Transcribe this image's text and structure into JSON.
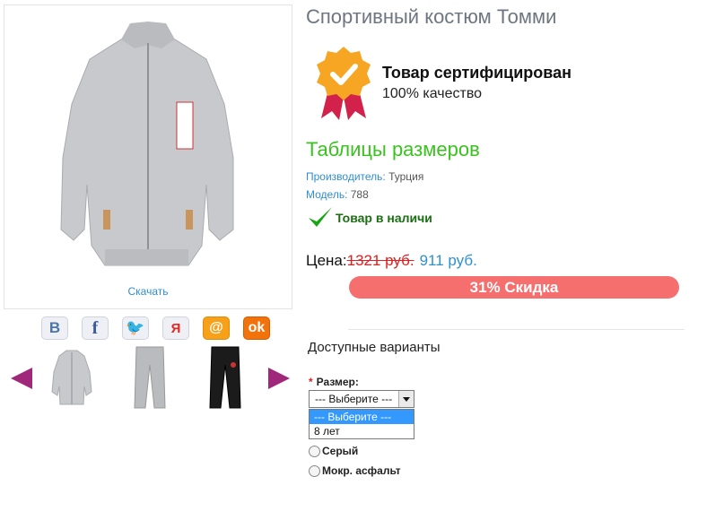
{
  "product": {
    "title": "Спортивный костюм Томми",
    "download_label": "Скачать",
    "certificate": {
      "title": "Товар сертифицирован",
      "subtitle": "100% качество"
    },
    "size_table_label": "Таблицы размеров",
    "manufacturer": {
      "label": "Производитель:",
      "value": "Турция"
    },
    "model": {
      "label": "Модель:",
      "value": "788"
    },
    "stock_label": "Товар в наличи",
    "price": {
      "label": "Цена:",
      "old": "1321 руб.",
      "new": "911 руб."
    },
    "discount_label": "31% Скидка"
  },
  "social": [
    {
      "name": "vk",
      "glyph": "B"
    },
    {
      "name": "facebook",
      "glyph": "f"
    },
    {
      "name": "twitter",
      "glyph": "🐦"
    },
    {
      "name": "yandex",
      "glyph": "Я"
    },
    {
      "name": "mail",
      "glyph": "@"
    },
    {
      "name": "odnoklassniki",
      "glyph": "ok"
    }
  ],
  "variants": {
    "heading": "Доступные варианты",
    "size_label": "Размер:",
    "required_mark": "*",
    "size_select": {
      "value": "--- Выберите ---",
      "options": [
        "--- Выберите ---",
        "8 лет"
      ]
    },
    "colors": [
      "Серый",
      "Мокр. асфальт"
    ]
  },
  "colors": {
    "accent_green": "#3ac21f",
    "link_blue": "#2f8fcf",
    "discount_red": "#f66f6f",
    "arrow_purple": "#a0287a"
  }
}
